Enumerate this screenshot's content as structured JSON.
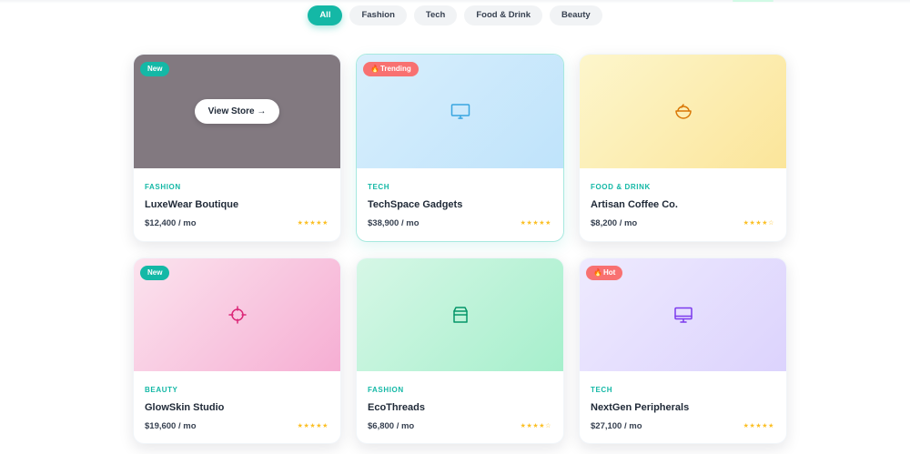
{
  "filters": [
    {
      "label": "All",
      "active": true
    },
    {
      "label": "Fashion",
      "active": false
    },
    {
      "label": "Tech",
      "active": false
    },
    {
      "label": "Food & Drink",
      "active": false
    },
    {
      "label": "Beauty",
      "active": false
    }
  ],
  "colors": {
    "accent": "#14b8a6",
    "hot_badge": "#f87171",
    "star": "#fbbf24"
  },
  "stores": [
    {
      "badge": "New",
      "badge_type": "new",
      "hover_button": "View Store →",
      "category": "FASHION",
      "name": "LuxeWear Boutique",
      "price": "$12,400 / mo",
      "rating_text": "★★★★★",
      "icon": "shirt-icon"
    },
    {
      "badge": "Trending",
      "badge_type": "hot",
      "badge_icon": "🔥",
      "category": "TECH",
      "name": "TechSpace Gadgets",
      "price": "$38,900 / mo",
      "rating_text": "★★★★★",
      "icon": "monitor-icon"
    },
    {
      "badge": "",
      "category": "FOOD & DRINK",
      "name": "Artisan Coffee Co.",
      "price": "$8,200 / mo",
      "rating_text": "★★★★☆",
      "icon": "coffee-bowl-icon"
    },
    {
      "badge": "New",
      "badge_type": "new",
      "category": "BEAUTY",
      "name": "GlowSkin Studio",
      "price": "$19,600 / mo",
      "rating_text": "★★★★★",
      "icon": "crosshair-icon"
    },
    {
      "badge": "",
      "category": "FASHION",
      "name": "EcoThreads",
      "price": "$6,800 / mo",
      "rating_text": "★★★★☆",
      "icon": "bag-icon"
    },
    {
      "badge": "Hot",
      "badge_type": "hot",
      "badge_icon": "🔥",
      "category": "TECH",
      "name": "NextGen Peripherals",
      "price": "$27,100 / mo",
      "rating_text": "★★★★★",
      "icon": "desktop-icon"
    }
  ]
}
